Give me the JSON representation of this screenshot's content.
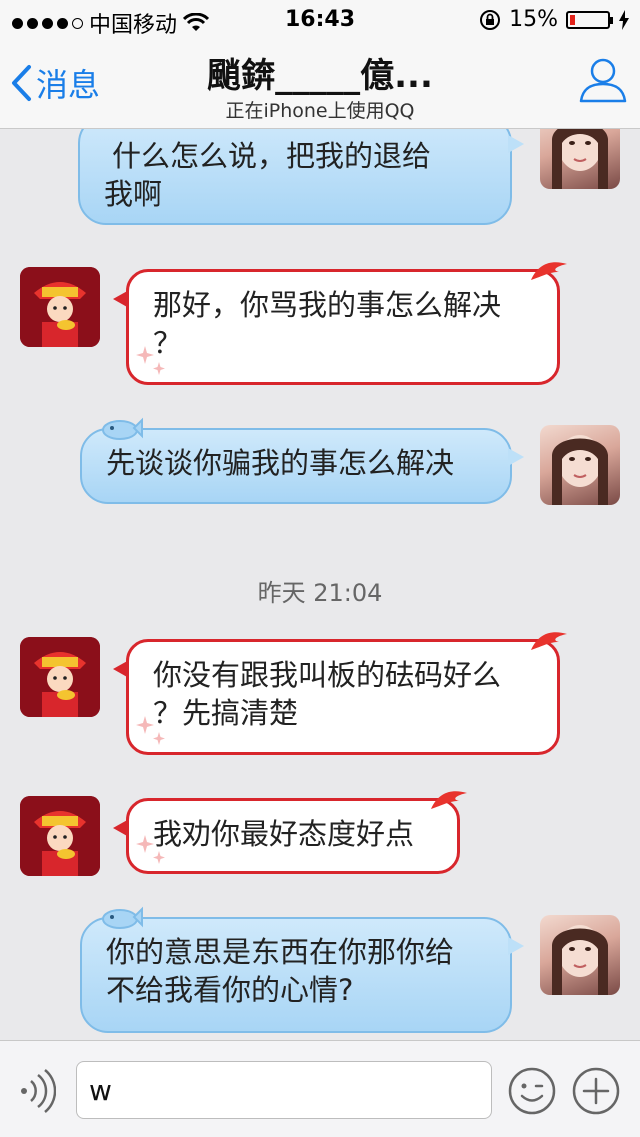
{
  "status_bar": {
    "carrier": "中国移动",
    "time": "16:43",
    "battery_percent": "15%",
    "battery_level": 0.15,
    "signal_bars_filled": 4,
    "signal_bars_total": 5
  },
  "nav": {
    "back_label": "消息",
    "title": "颵錛_____億...",
    "subtitle": "正在iPhone上使用QQ"
  },
  "messages": [
    {
      "side": "right",
      "text": "什么怎么说，把我的退给我啊",
      "lines": [
        "什么怎么说，把我的退给",
        "我啊"
      ]
    },
    {
      "side": "left",
      "text": "那好，你骂我的事怎么解决？",
      "lines": [
        "那好，你骂我的事怎么解决",
        "？"
      ]
    },
    {
      "side": "right",
      "text": "先谈谈你骗我的事怎么解决",
      "lines": [
        "先谈谈你骗我的事怎么解决"
      ]
    },
    {
      "side": "left",
      "text": "你没有跟我叫板的砝码好么？先搞清楚",
      "lines": [
        "你没有跟我叫板的砝码好么",
        "？先搞清楚"
      ]
    },
    {
      "side": "left",
      "text": "我劝你最好态度好点",
      "lines": [
        "我劝你最好态度好点"
      ]
    },
    {
      "side": "right",
      "text": "你的意思是东西在你那你给不给我看你的心情?",
      "lines": [
        "你的意思是东西在你那你给",
        "不给我看你的心情?"
      ]
    }
  ],
  "timestamp": "昨天 21:04",
  "input": {
    "value": "w"
  },
  "colors": {
    "accent": "#1a7ee8",
    "blue_bubble": "#bde0f8",
    "red_bubble_border": "#d8262c",
    "background": "#e9e9eb"
  },
  "icons": {
    "back": "chevron-left-icon",
    "profile": "person-icon",
    "voice": "voice-icon",
    "emoji": "emoji-icon",
    "plus": "plus-icon"
  }
}
